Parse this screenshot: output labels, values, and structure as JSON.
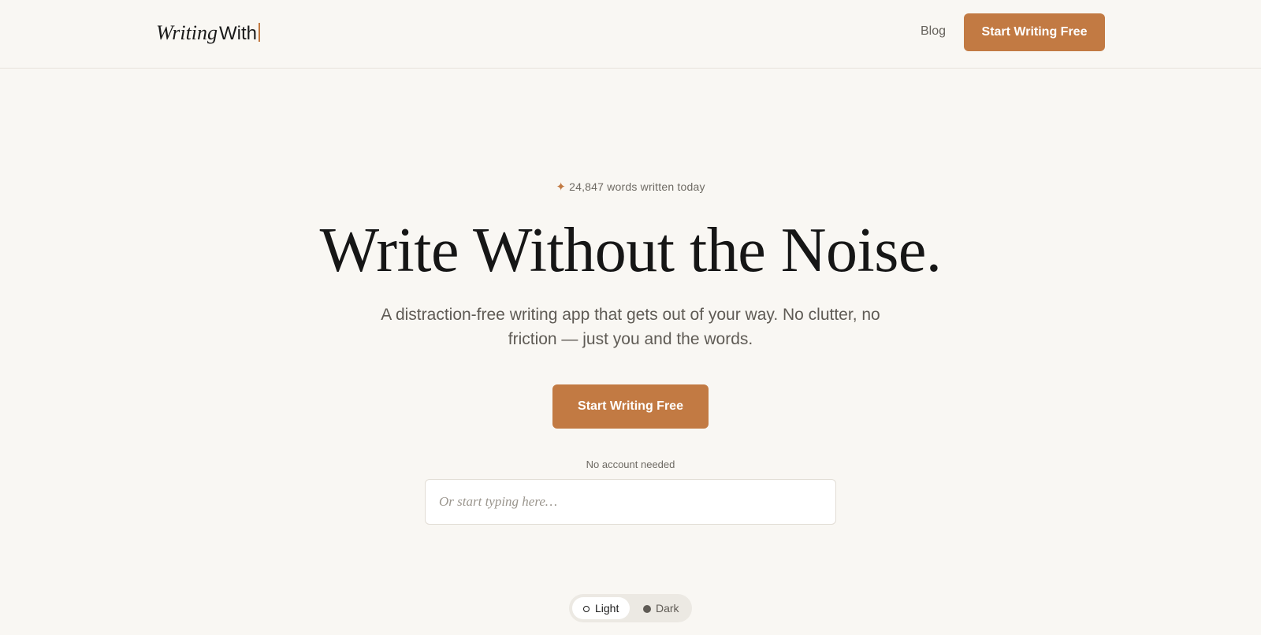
{
  "header": {
    "logo_italic": "Writing",
    "logo_plain": "With",
    "nav_blog": "Blog",
    "cta_label": "Start Writing Free"
  },
  "hero": {
    "stat_icon": "✦",
    "stat_text": "24,847 words written today",
    "headline": "Write Without the Noise.",
    "subhead": "A distraction-free writing app that gets out of your way. No clutter, no friction — just you and the words.",
    "cta_label": "Start Writing Free",
    "note": "No account needed",
    "typing_placeholder": "Or start typing here…"
  },
  "theme_toggle": {
    "light_label": "Light",
    "dark_label": "Dark",
    "selected": "Light"
  },
  "colors": {
    "accent": "#c27a43",
    "background": "#f9f7f3",
    "text": "#161616",
    "muted": "#6e6a63"
  },
  "icons": {
    "stat": "sparkle-icon",
    "light": "sun-icon",
    "dark": "moon-icon"
  }
}
